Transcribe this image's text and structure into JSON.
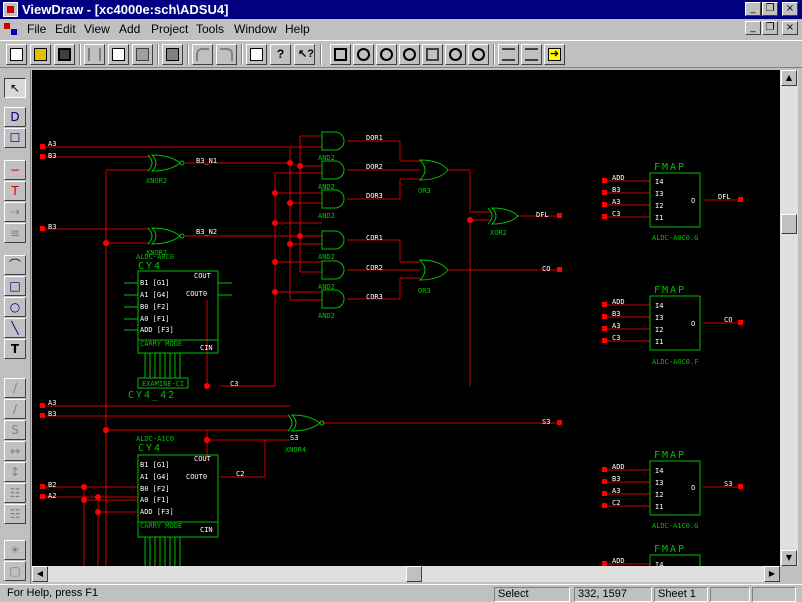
{
  "window": {
    "title": "ViewDraw - [xc4000e:sch\\ADSU4]",
    "buttons": {
      "minimize": "_",
      "restore": "❐",
      "close": "×"
    }
  },
  "menu": {
    "items": [
      "File",
      "Edit",
      "View",
      "Add",
      "Project",
      "Tools",
      "Window",
      "Help"
    ]
  },
  "toolbar": {
    "icons": [
      "new-icon",
      "open-icon",
      "save-icon",
      "cut-icon",
      "copy-icon",
      "paste-icon",
      "print-icon",
      "undo-icon",
      "redo-icon",
      "properties-icon",
      "help-icon",
      "context-help-icon",
      "zoom-fit-icon",
      "zoom-in-icon",
      "zoom-out-icon",
      "zoom-area-icon",
      "zoom-select-icon",
      "pan-icon",
      "redraw-icon",
      "push-icon",
      "pop-icon",
      "arrow-right-icon"
    ]
  },
  "palette": {
    "tools": [
      {
        "name": "select",
        "glyph": "↖"
      },
      {
        "name": "component",
        "glyph": "D"
      },
      {
        "name": "zoom-box",
        "glyph": "☐"
      },
      {
        "name": "net",
        "glyph": "−"
      },
      {
        "name": "bus-tap",
        "glyph": "T"
      },
      {
        "name": "bus",
        "glyph": "⇢"
      },
      {
        "name": "hatch",
        "glyph": "≡"
      },
      {
        "name": "arc",
        "glyph": "⌒"
      },
      {
        "name": "box",
        "glyph": "□"
      },
      {
        "name": "circle",
        "glyph": "○"
      },
      {
        "name": "line",
        "glyph": "╲"
      },
      {
        "name": "text",
        "glyph": "T"
      },
      {
        "name": "pencil",
        "glyph": "∕"
      },
      {
        "name": "brush",
        "glyph": "∕"
      },
      {
        "name": "rotate",
        "glyph": "S"
      },
      {
        "name": "flip",
        "glyph": "↔"
      },
      {
        "name": "mirror",
        "glyph": "↕"
      },
      {
        "name": "group",
        "glyph": "☷"
      },
      {
        "name": "ungroup",
        "glyph": "☷"
      },
      {
        "name": "light",
        "glyph": "☀"
      },
      {
        "name": "marker",
        "glyph": "▢"
      }
    ]
  },
  "schematic": {
    "inputs_top": [
      "A3",
      "B3",
      "B3"
    ],
    "xnor_labels": [
      "XNOR2",
      "XNOR2"
    ],
    "xnor_nets": [
      "B3_N1",
      "B3_N2"
    ],
    "and_label": "AND2",
    "and_nets": [
      "DOR1",
      "DOR2",
      "DOR3",
      "COR1",
      "COR2",
      "COR3"
    ],
    "or_label": "OR3",
    "xor_label": "XOR2",
    "out_dfl": "DFL",
    "out_co": "CO",
    "cy4_top": {
      "attr": "ALDC-A0C0",
      "name": "CY4",
      "pins_left": [
        "B1 [G1]",
        "A1 [G4]",
        "B0 [F2]",
        "A0 [F1]",
        "ADD [F3]"
      ],
      "pins_right": [
        "COUT",
        "COUT0",
        "CIN"
      ],
      "mode": "CARRY MODE",
      "sub": "EXAMINE-CI",
      "instance": "CY4_42",
      "net": "C3"
    },
    "mid_inputs": [
      "A3",
      "B3"
    ],
    "xnor4_label": "XNOR4",
    "s3_net": "S3",
    "cy4_bot": {
      "attr": "ALDC-A1C0",
      "name": "CY4",
      "pins_left": [
        "B1 [G1]",
        "A1 [G4]",
        "B0 [F2]",
        "A0 [F1]",
        "ADD [F3]"
      ],
      "pins_right": [
        "COUT",
        "COUT0",
        "CIN"
      ],
      "mode": "CARRY MODE",
      "net": "C2",
      "inputs": [
        "B2",
        "A2"
      ]
    },
    "fmaps": [
      {
        "title": "FMAP",
        "inputs": [
          "ADD",
          "B3",
          "A3",
          "C3"
        ],
        "pins": [
          "I4",
          "I3",
          "I2",
          "I1"
        ],
        "out_pin": "O",
        "out_net": "DFL",
        "attr": "ALDC-A0C0.G"
      },
      {
        "title": "FMAP",
        "inputs": [
          "ADD",
          "B3",
          "A3",
          "C3"
        ],
        "pins": [
          "I4",
          "I3",
          "I2",
          "I1"
        ],
        "out_pin": "O",
        "out_net": "CO",
        "attr": "ALDC-A0C0.F"
      },
      {
        "title": "FMAP",
        "inputs": [
          "ADD",
          "B3",
          "A3",
          "C2"
        ],
        "pins": [
          "I4",
          "I3",
          "I2",
          "I1"
        ],
        "out_pin": "O",
        "out_net": "S3",
        "attr": "ALDC-A1C0.G"
      },
      {
        "title": "FMAP",
        "inputs": [
          "ADD"
        ],
        "pins": [
          "I4"
        ],
        "out_pin": "",
        "out_net": "",
        "attr": ""
      }
    ]
  },
  "status": {
    "help": "For Help, press F1",
    "mode": "Select",
    "coords": "332, 1597",
    "sheet": "Sheet 1"
  },
  "colors": {
    "wire": "#d00000",
    "symbol": "#00c000",
    "text": "#ffffff",
    "background": "#000000"
  }
}
